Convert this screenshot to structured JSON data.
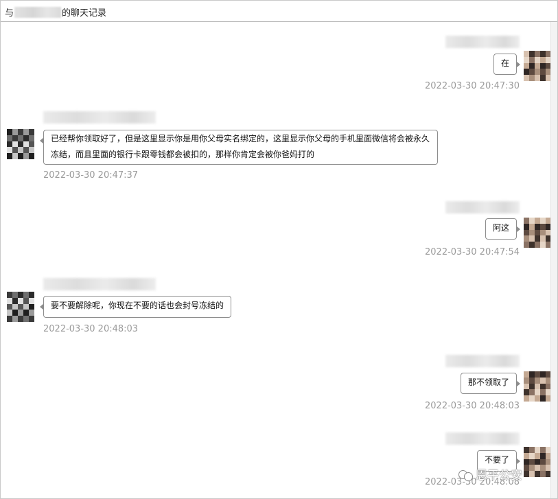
{
  "window": {
    "title_prefix": "与",
    "title_suffix": "的聊天记录"
  },
  "messages": [
    {
      "side": "right",
      "text": "在",
      "time": "2022-03-30 20:47:30"
    },
    {
      "side": "left",
      "lines": [
        "已经帮你领取好了，但是这里显示你是用你父母实名绑定的，这里显示你父母的手机里面微信将会被永久",
        "冻结，而且里面的银行卡跟零钱都会被扣的，那样你肯定会被你爸妈打的"
      ],
      "time": "2022-03-30 20:47:37"
    },
    {
      "side": "right",
      "text": "阿这",
      "time": "2022-03-30 20:47:54"
    },
    {
      "side": "left",
      "lines": [
        "要不要解除呢，你现在不要的话也会封号冻结的"
      ],
      "time": "2022-03-30 20:48:03"
    },
    {
      "side": "right",
      "text": "那不领取了",
      "time": "2022-03-30 20:48:03"
    },
    {
      "side": "right",
      "text": "不要了",
      "time": "2022-03-30 20:48:08"
    }
  ],
  "watermark": {
    "text": "恩平公安",
    "icon": "wechat-channel-icon"
  },
  "colors": {
    "bubble_border": "#8d8d8d",
    "timestamp": "#9a9a9a",
    "background": "#ffffff"
  }
}
